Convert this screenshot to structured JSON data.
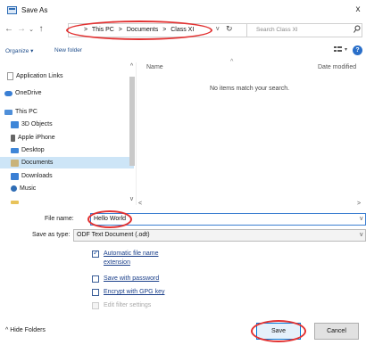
{
  "window": {
    "title": "Save As",
    "close_glyph": "x"
  },
  "nav_buttons": {
    "back": "←",
    "forward": "→",
    "dropdown": "⌄",
    "up": "↑"
  },
  "breadcrumb": [
    "This PC",
    "Documents",
    "Class XI"
  ],
  "breadcrumb_sep": ">",
  "address_dropdown": "v",
  "refresh_glyph": "↻",
  "search": {
    "placeholder": "Search Class XI"
  },
  "toolbar": {
    "organize": "Organize ▾",
    "new_folder": "New folder",
    "help": "?"
  },
  "nav_pane": {
    "items": [
      {
        "label": "Application Links",
        "icon": "file-icon"
      },
      {
        "label": "OneDrive",
        "icon": "cloud-icon"
      },
      {
        "label": "This PC",
        "icon": "pc-icon"
      },
      {
        "label": "3D Objects",
        "icon": "cube-icon"
      },
      {
        "label": "Apple iPhone",
        "icon": "phone-icon"
      },
      {
        "label": "Desktop",
        "icon": "desktop-icon"
      },
      {
        "label": "Documents",
        "icon": "folder-icon",
        "selected": true
      },
      {
        "label": "Downloads",
        "icon": "download-icon"
      },
      {
        "label": "Music",
        "icon": "music-icon"
      }
    ]
  },
  "content": {
    "col_name": "Name",
    "col_date": "Date modified",
    "sort_caret": "^",
    "empty_message": "No items match your search."
  },
  "form": {
    "file_name_label": "File name:",
    "file_name_value": "Hello World",
    "save_as_type_label": "Save as type:",
    "save_as_type_value": "ODF Text Document (.odt)",
    "options": [
      {
        "label": "Automatic file name extension",
        "line1": "Automatic file name",
        "line2": "extension",
        "checked": true,
        "enabled": true
      },
      {
        "label": "Save with password",
        "checked": false,
        "enabled": true
      },
      {
        "label": "Encrypt with GPG key",
        "checked": false,
        "enabled": true
      },
      {
        "label": "Edit filter settings",
        "checked": false,
        "enabled": false
      }
    ]
  },
  "footer": {
    "hide_folders": "^ Hide Folders",
    "save": "Save",
    "cancel": "Cancel"
  },
  "colors": {
    "accent": "#0078d7",
    "annotation_red": "#e23232",
    "selection": "#cde5f7"
  }
}
